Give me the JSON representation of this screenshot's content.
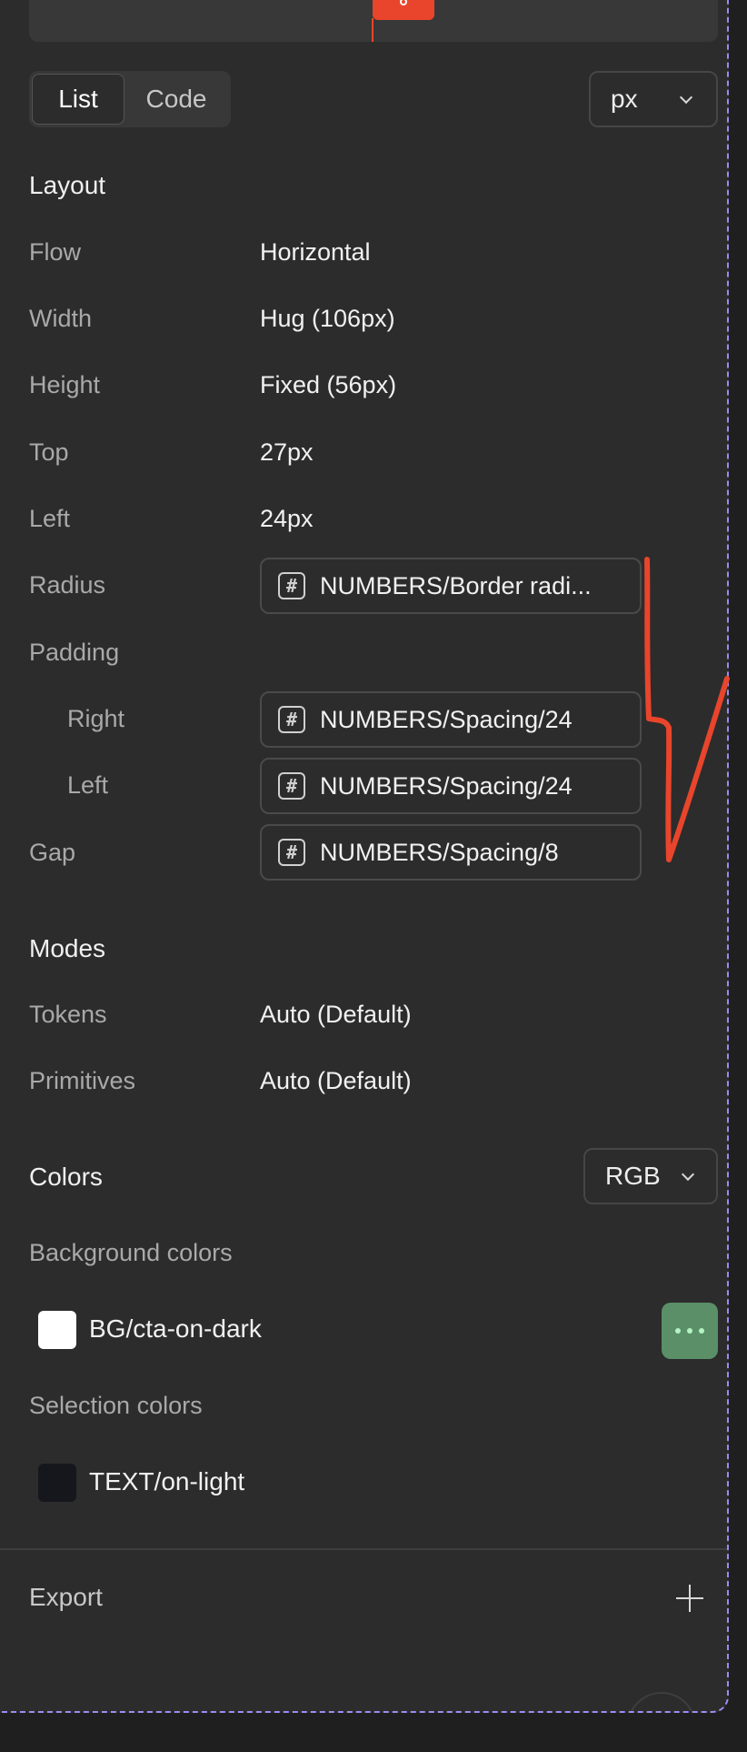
{
  "view_toggle": {
    "list_label": "List",
    "code_label": "Code",
    "active": "List"
  },
  "unit_select": {
    "value": "px"
  },
  "layout": {
    "title": "Layout",
    "rows": [
      {
        "label": "Flow",
        "value": "Horizontal"
      },
      {
        "label": "Width",
        "value": "Hug (106px)"
      },
      {
        "label": "Height",
        "value": "Fixed (56px)"
      },
      {
        "label": "Top",
        "value": "27px"
      },
      {
        "label": "Left",
        "value": "24px"
      }
    ],
    "radius": {
      "label": "Radius",
      "token": "NUMBERS/Border radi..."
    },
    "padding": {
      "label": "Padding",
      "right": {
        "label": "Right",
        "token": "NUMBERS/Spacing/24"
      },
      "left": {
        "label": "Left",
        "token": "NUMBERS/Spacing/24"
      }
    },
    "gap": {
      "label": "Gap",
      "token": "NUMBERS/Spacing/8"
    }
  },
  "modes": {
    "title": "Modes",
    "rows": [
      {
        "label": "Tokens",
        "value": "Auto (Default)"
      },
      {
        "label": "Primitives",
        "value": "Auto (Default)"
      }
    ]
  },
  "colors": {
    "title": "Colors",
    "format_select": "RGB",
    "background_title": "Background colors",
    "background": {
      "name": "BG/cta-on-dark",
      "swatch": "#ffffff"
    },
    "selection_title": "Selection colors",
    "selection": {
      "name": "TEXT/on-light",
      "swatch": "#16161d"
    }
  },
  "export": {
    "title": "Export"
  },
  "icons": {
    "unit_chevron": "chevron-down-icon",
    "token": "hash-icon",
    "more": "more-dots-icon",
    "add": "plus-icon"
  },
  "theme": {
    "panel_bg": "#2c2c2c",
    "selection_outline": "#9d8cf0",
    "annotation": "#e8452c",
    "more_button": "#5a8f68"
  }
}
